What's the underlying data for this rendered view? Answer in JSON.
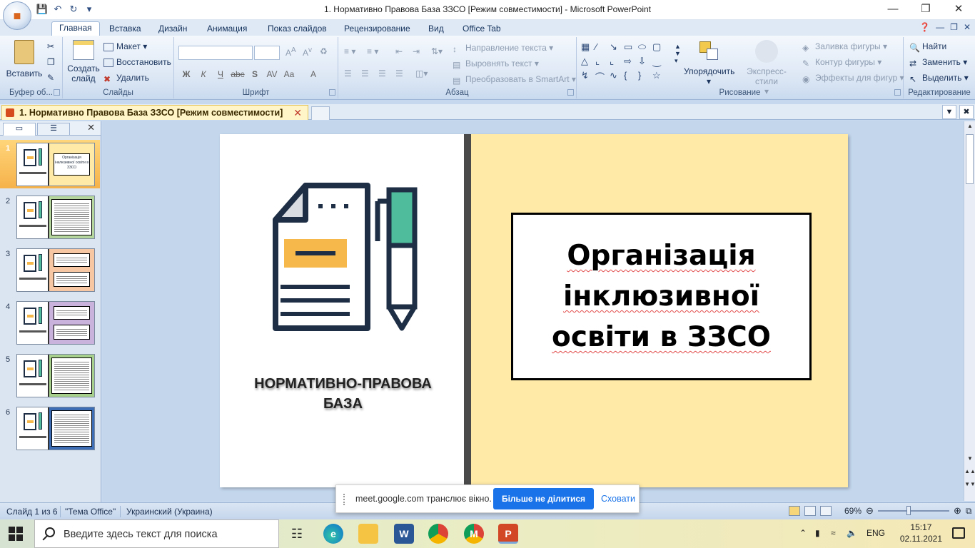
{
  "window": {
    "title": "1. Нормативно Правова База ЗЗСО [Режим совместимости] - Microsoft PowerPoint"
  },
  "ribbon": {
    "tabs": [
      "Главная",
      "Вставка",
      "Дизайн",
      "Анимация",
      "Показ слайдов",
      "Рецензирование",
      "Вид",
      "Office Tab"
    ],
    "active_tab": "Главная",
    "clipboard": {
      "paste": "Вставить",
      "label": "Буфер об..."
    },
    "slides": {
      "new_slide_1": "Создать",
      "new_slide_2": "слайд",
      "layout": "Макет",
      "reset": "Восстановить",
      "delete": "Удалить",
      "label": "Слайды"
    },
    "font": {
      "label": "Шрифт"
    },
    "paragraph": {
      "text_direction": "Направление текста",
      "align_text": "Выровнять текст",
      "smartart": "Преобразовать в SmartArt",
      "label": "Абзац"
    },
    "drawing": {
      "arrange": "Упорядочить",
      "quick_styles": "Экспресс-стили",
      "shape_fill": "Заливка фигуры",
      "shape_outline": "Контур фигуры",
      "shape_effects": "Эффекты для фигур",
      "label": "Рисование"
    },
    "editing": {
      "find": "Найти",
      "replace": "Заменить",
      "select": "Выделить",
      "label": "Редактирование"
    }
  },
  "document_tab": {
    "title": "1. Нормативно Правова База ЗЗСО [Режим совместимости]"
  },
  "slides_panel": {
    "numbers": [
      "1",
      "2",
      "3",
      "4",
      "5",
      "6"
    ],
    "thumb_colors": [
      "#ffeaa7",
      "#b5d69c",
      "#f7c6a3",
      "#c9b3dc",
      "#a8d08d",
      "#3c6db5"
    ],
    "thumb1_text": "Організація інклюзивної освіти в ЗЗСО"
  },
  "slide": {
    "caption": "НОРМАТИВНО-ПРАВОВА БАЗА",
    "title": "Організація інклюзивної освіти в ЗЗСО",
    "colors": {
      "right_bg": "#ffeaa7",
      "doc_accent": "#f7b84b",
      "pen_green": "#4fbd9b",
      "outline": "#1d2e45"
    }
  },
  "statusbar": {
    "slide_info": "Слайд 1 из 6",
    "theme": "\"Тема Office\"",
    "language": "Украинский (Украина)",
    "zoom": "69%"
  },
  "meet_banner": {
    "text": "meet.google.com транслює вікно.",
    "stop_button": "Більше не ділитися",
    "hide_button": "Сховати"
  },
  "taskbar": {
    "search_placeholder": "Введите здесь текст для поиска",
    "language": "ENG",
    "time": "15:17",
    "date": "02.11.2021"
  }
}
